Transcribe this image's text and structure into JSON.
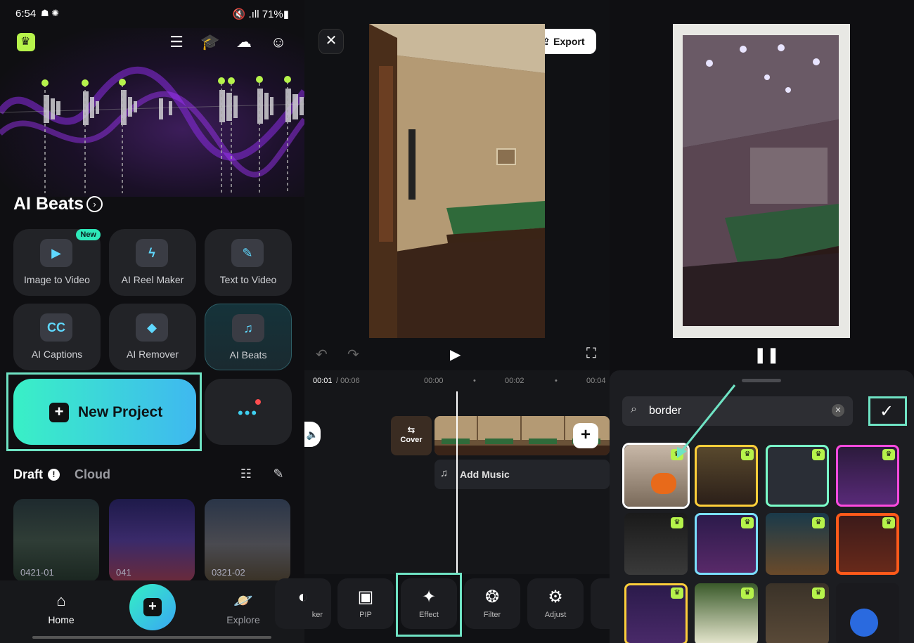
{
  "status": {
    "time": "6:54",
    "icons": "☗ ✺",
    "right": "🔇 .ıll 71%▮"
  },
  "left": {
    "section_title": "AI Beats",
    "tiles": [
      {
        "label": "Image to Video",
        "badge": "New"
      },
      {
        "label": "AI Reel Maker"
      },
      {
        "label": "Text to Video"
      },
      {
        "label": "AI Captions",
        "glyph": "CC"
      },
      {
        "label": "AI Remover"
      },
      {
        "label": "AI Beats"
      }
    ],
    "new_project": "New Project",
    "tabs": {
      "draft": "Draft",
      "cloud": "Cloud"
    },
    "drafts": [
      {
        "caption": "0421-01"
      },
      {
        "caption": "041"
      },
      {
        "caption": "0321-02"
      }
    ],
    "nav": {
      "home": "Home",
      "explore": "Explore"
    }
  },
  "editor": {
    "export_label": "Export",
    "time_current": "00:01",
    "time_total": " / 00:06",
    "ticks": [
      "00:00",
      "00:02",
      "00:04"
    ],
    "cover_label": "Cover",
    "add_music": "Add Music",
    "tools": [
      {
        "label": "ker"
      },
      {
        "label": "PIP"
      },
      {
        "label": "Effect"
      },
      {
        "label": "Filter"
      },
      {
        "label": "Adjust"
      }
    ]
  },
  "effects": {
    "search_value": "border"
  },
  "colors": {
    "accent": "#6fe3c4",
    "crown": "#b6f34b",
    "gradient_start": "#39f0c6",
    "gradient_end": "#3fb8f0"
  }
}
